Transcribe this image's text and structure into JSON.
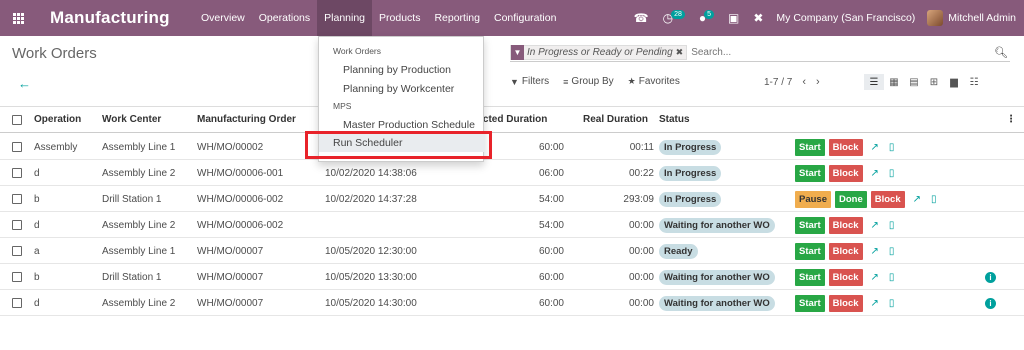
{
  "navbar": {
    "app_title": "Manufacturing",
    "menu": [
      "Overview",
      "Operations",
      "Planning",
      "Products",
      "Reporting",
      "Configuration"
    ],
    "active_menu": "Planning",
    "activity_count": "28",
    "message_count": "5",
    "company": "My Company (San Francisco)",
    "user": "Mitchell Admin"
  },
  "control_panel": {
    "title": "Work Orders",
    "search_facet": "In Progress or Ready or Pending",
    "search_placeholder": "Search...",
    "filters_label": "Filters",
    "group_by_label": "Group By",
    "favorites_label": "Favorites",
    "pager": "1-7 / 7"
  },
  "dropdown": {
    "header_work_orders": "Work Orders",
    "planning_by_production": "Planning by Production",
    "planning_by_workcenter": "Planning by Workcenter",
    "header_mps": "MPS",
    "master_production_schedule": "Master Production Schedule",
    "run_scheduler": "Run Scheduler"
  },
  "table": {
    "columns": {
      "operation": "Operation",
      "work_center": "Work Center",
      "manufacturing_order": "Manufacturing Order",
      "expected_duration": "Expected Duration",
      "real_duration": "Real Duration",
      "status": "Status"
    },
    "rows": [
      {
        "operation": "Assembly",
        "work_center": "Assembly Line 1",
        "mo": "WH/MO/00002",
        "date": "",
        "expected": "60:00",
        "real": "00:11",
        "status": "In Progress",
        "actions": [
          "Start",
          "Block"
        ],
        "info": false
      },
      {
        "operation": "d",
        "work_center": "Assembly Line 2",
        "mo": "WH/MO/00006-001",
        "date": "10/02/2020 14:38:06",
        "expected": "06:00",
        "real": "00:22",
        "status": "In Progress",
        "actions": [
          "Start",
          "Block"
        ],
        "info": false
      },
      {
        "operation": "b",
        "work_center": "Drill Station 1",
        "mo": "WH/MO/00006-002",
        "date": "10/02/2020 14:37:28",
        "expected": "54:00",
        "real": "293:09",
        "status": "In Progress",
        "actions": [
          "Pause",
          "Done",
          "Block"
        ],
        "info": false
      },
      {
        "operation": "d",
        "work_center": "Assembly Line 2",
        "mo": "WH/MO/00006-002",
        "date": "",
        "expected": "54:00",
        "real": "00:00",
        "status": "Waiting for another WO",
        "actions": [
          "Start",
          "Block"
        ],
        "info": false
      },
      {
        "operation": "a",
        "work_center": "Assembly Line 1",
        "mo": "WH/MO/00007",
        "date": "10/05/2020 12:30:00",
        "expected": "60:00",
        "real": "00:00",
        "status": "Ready",
        "actions": [
          "Start",
          "Block"
        ],
        "info": false
      },
      {
        "operation": "b",
        "work_center": "Drill Station 1",
        "mo": "WH/MO/00007",
        "date": "10/05/2020 13:30:00",
        "expected": "60:00",
        "real": "00:00",
        "status": "Waiting for another WO",
        "actions": [
          "Start",
          "Block"
        ],
        "info": true
      },
      {
        "operation": "d",
        "work_center": "Assembly Line 2",
        "mo": "WH/MO/00007",
        "date": "10/05/2020 14:30:00",
        "expected": "60:00",
        "real": "00:00",
        "status": "Waiting for another WO",
        "actions": [
          "Start",
          "Block"
        ],
        "info": true
      }
    ]
  }
}
